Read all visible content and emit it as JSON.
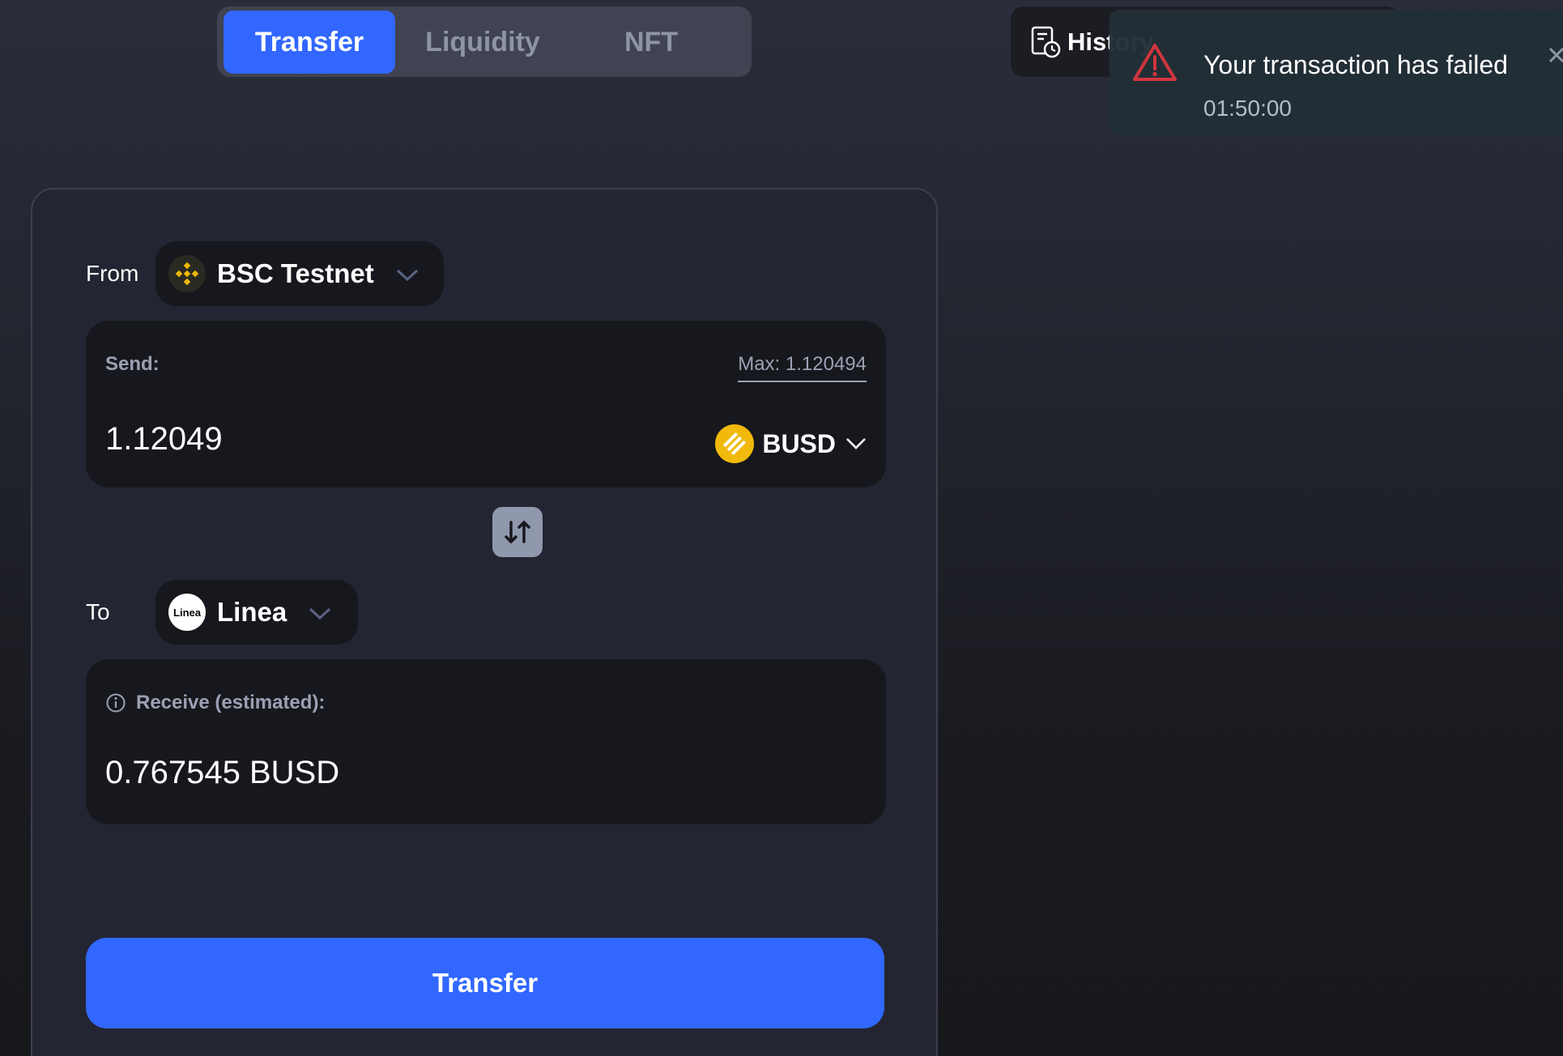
{
  "tabs": [
    {
      "label": "Transfer",
      "active": true
    },
    {
      "label": "Liquidity",
      "active": false
    },
    {
      "label": "NFT",
      "active": false
    }
  ],
  "header": {
    "history_label": "History"
  },
  "toast": {
    "title": "Your transaction has failed",
    "time": "01:50:00",
    "icon": "warning-triangle-icon",
    "color": "#d2353e"
  },
  "from": {
    "label": "From",
    "chain": "BSC Testnet",
    "chain_icon": "bnb-chain-icon"
  },
  "send": {
    "label": "Send:",
    "max_label": "Max: 1.120494",
    "amount": "1.12049",
    "token": "BUSD",
    "token_icon": "busd-icon"
  },
  "to": {
    "label": "To",
    "chain": "Linea",
    "chain_icon": "linea-icon",
    "chain_logo_text": "Linea"
  },
  "receive": {
    "label": "Receive (estimated):",
    "value": "0.767545 BUSD"
  },
  "transfer_button": "Transfer",
  "colors": {
    "accent": "#3167ff",
    "bnb_yellow": "#f0b90b",
    "error_red": "#d2353e"
  }
}
